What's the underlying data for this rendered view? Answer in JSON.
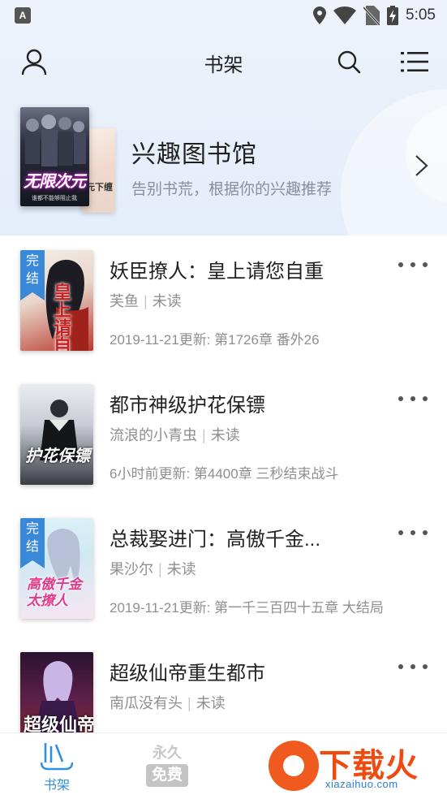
{
  "status_bar": {
    "time": "5:05"
  },
  "app_bar": {
    "title": "书架",
    "left_icon": "user-icon",
    "search_icon": "search-icon",
    "menu_icon": "list-menu-icon"
  },
  "library_banner": {
    "title": "兴趣图书馆",
    "subtitle": "告别书荒，根据你的兴趣推荐",
    "front_cover_title": "无限次元",
    "front_cover_subtitle": "谁都不能够阻止我",
    "back_cover_title": "元下缠"
  },
  "books": [
    {
      "title": "妖臣撩人：皇上请您自重",
      "author": "芙鱼",
      "status": "未读",
      "update": "2019-11-21更新: 第1726章  番外26",
      "badge": "完结",
      "cover_text": "皇上请自重"
    },
    {
      "title": "都市神级护花保镖",
      "author": "流浪的小青虫",
      "status": "未读",
      "update": "6小时前更新: 第4400章 三秒结束战斗",
      "badge": "",
      "cover_text": "护花保镖"
    },
    {
      "title": "总裁娶进门：高傲千金...",
      "author": "果沙尔",
      "status": "未读",
      "update": "2019-11-21更新: 第一千三百四十五章  大结局",
      "badge": "完结",
      "cover_text": "高傲千金太撩人"
    },
    {
      "title": "超级仙帝重生都市",
      "author": "南瓜没有头",
      "status": "未读",
      "update": "",
      "badge": "",
      "cover_text": "超级仙帝"
    }
  ],
  "bottom_nav": {
    "shelf_label": "书架",
    "free_top": "永久",
    "free_bottom": "免费"
  },
  "watermark": {
    "text": "下载火",
    "url": "xiazaihuo.com"
  },
  "colors": {
    "accent": "#2f8fe0",
    "badge": "#3a88d8",
    "watermark": "#ee4b10"
  }
}
